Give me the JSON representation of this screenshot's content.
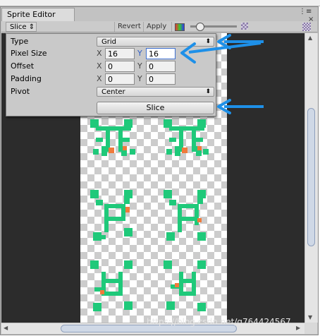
{
  "window": {
    "tab_title": "Sprite Editor",
    "controls": [
      "⋮≡",
      "×"
    ]
  },
  "toolbar": {
    "slice_menu": "Slice",
    "revert_label": "Revert",
    "apply_label": "Apply",
    "zoom_level": 0.15
  },
  "slice_panel": {
    "type_label": "Type",
    "type_value": "Grid",
    "pixel_size_label": "Pixel Size",
    "pixel_size_x": "16",
    "pixel_size_y": "16",
    "offset_label": "Offset",
    "offset_x": "0",
    "offset_y": "0",
    "padding_label": "Padding",
    "padding_x": "0",
    "padding_y": "0",
    "pivot_label": "Pivot",
    "pivot_value": "Center",
    "slice_button": "Slice",
    "x_label": "X",
    "y_label": "Y"
  },
  "watermark": "https://blog.csdn.net/q764424567",
  "colors": {
    "sprite_green": "#1fc97a",
    "sprite_orange": "#f07a3b",
    "annotation_arrow": "#1e90e8"
  }
}
